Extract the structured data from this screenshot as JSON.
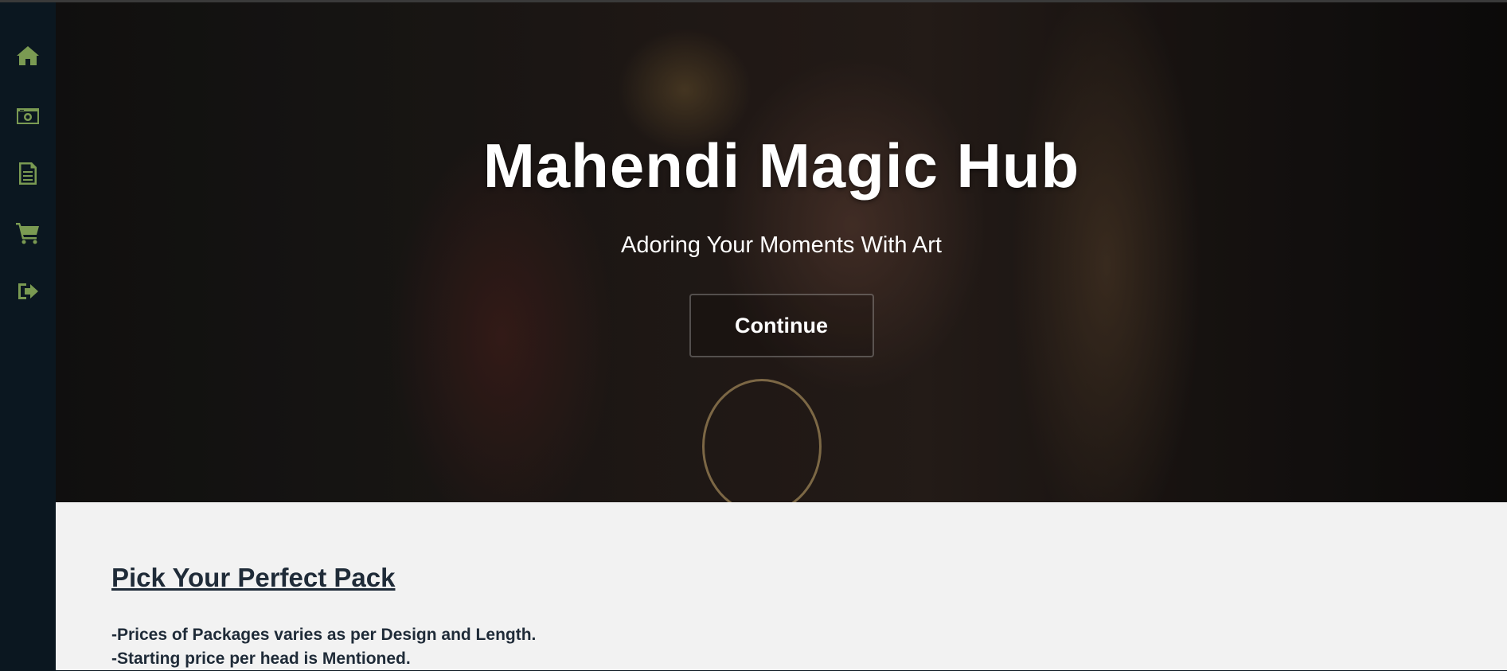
{
  "sidebar": {
    "items": [
      {
        "icon": "home-icon"
      },
      {
        "icon": "camera-icon"
      },
      {
        "icon": "document-icon"
      },
      {
        "icon": "cart-icon"
      },
      {
        "icon": "sign-out-icon"
      }
    ],
    "icon_color": "#7a9a52",
    "background": "#0b1720"
  },
  "hero": {
    "title": "Mahendi Magic Hub",
    "subtitle": "Adoring Your Moments With Art",
    "button_label": "Continue"
  },
  "packages": {
    "title": "Pick Your Perfect Pack",
    "lines": [
      "-Prices of Packages varies as per Design and Length.",
      "-Starting price per head is Mentioned."
    ]
  }
}
